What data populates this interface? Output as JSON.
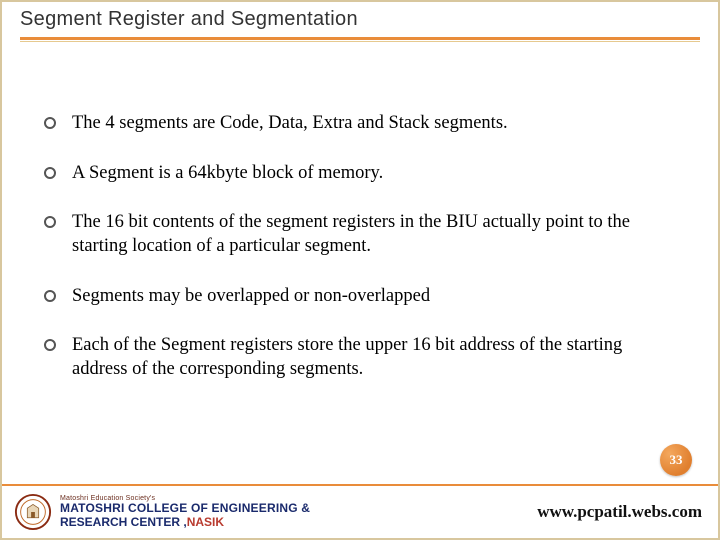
{
  "title": "Segment Register and Segmentation",
  "bullets": [
    "The 4 segments are Code, Data, Extra and Stack segments.",
    "A Segment is a 64kbyte block of memory.",
    "The 16 bit contents of the segment registers in the BIU actually point to the starting location of a particular segment.",
    "Segments may be overlapped or non-overlapped",
    "Each of the Segment registers store the upper 16 bit address of the starting address of the corresponding segments."
  ],
  "page_number": "33",
  "footer": {
    "tagline": "Matoshri Education Society's",
    "line2": "MATOSHRI COLLEGE OF ENGINEERING &",
    "line3_a": "RESEARCH CENTER ,",
    "line3_b": "NASIK",
    "url": "www.pcpatil.webs.com"
  }
}
